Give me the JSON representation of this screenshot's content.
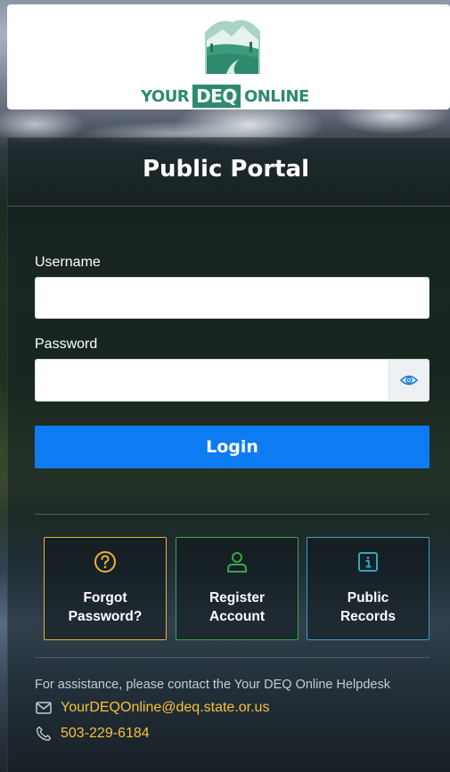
{
  "header": {
    "logo": {
      "word_left": "YOUR",
      "word_boxed": "DEQ",
      "word_right": "ONLINE"
    }
  },
  "portal": {
    "title": "Public Portal"
  },
  "form": {
    "username_label": "Username",
    "username_value": "",
    "password_label": "Password",
    "password_value": "",
    "show_password_icon": "eye-icon",
    "login_label": "Login"
  },
  "tiles": [
    {
      "icon": "question-circle-icon",
      "line1": "Forgot",
      "line2": "Password?",
      "color": "#e6b23a"
    },
    {
      "icon": "user-icon",
      "line1": "Register",
      "line2": "Account",
      "color": "#3aa64a"
    },
    {
      "icon": "info-square-icon",
      "line1": "Public",
      "line2": "Records",
      "color": "#3ba0c2"
    }
  ],
  "assistance": {
    "text": "For assistance, please contact the Your DEQ Online Helpdesk",
    "email_icon": "envelope-icon",
    "email": "YourDEQOnline@deq.state.or.us",
    "phone_icon": "phone-icon",
    "phone": "503-229-6184"
  },
  "colors": {
    "brand_green": "#2d8a6e",
    "login_blue": "#0d7cf2",
    "link_yellow": "#f6c13c"
  }
}
